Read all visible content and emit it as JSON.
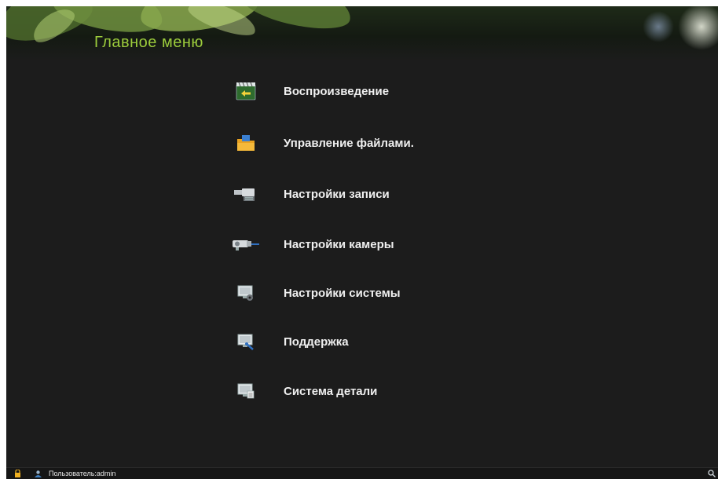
{
  "header": {
    "title": "Главное меню"
  },
  "menu": {
    "items": [
      {
        "label": "Воспроизведение",
        "icon": "playback-icon"
      },
      {
        "label": "Управление файлами.",
        "icon": "folder-icon"
      },
      {
        "label": "Настройки записи",
        "icon": "record-camera-icon"
      },
      {
        "label": "Настройки камеры",
        "icon": "camera-icon"
      },
      {
        "label": "Настройки системы",
        "icon": "system-settings-icon"
      },
      {
        "label": "Поддержка",
        "icon": "maintenance-icon"
      },
      {
        "label": "Система детали",
        "icon": "system-info-icon"
      }
    ]
  },
  "status_bar": {
    "user_text": "Пользователь:admin",
    "icons": [
      "lock-icon",
      "user-icon",
      "search-icon"
    ]
  },
  "colors": {
    "title": "#9ccc3c",
    "background": "#1c1c1c",
    "text": "#f0f0f0"
  }
}
